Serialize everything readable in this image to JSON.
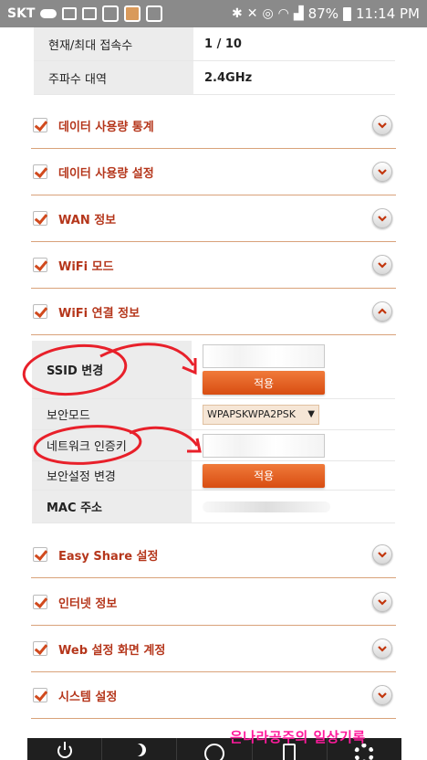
{
  "status_bar": {
    "carrier": "SKT",
    "battery": "87%",
    "time": "11:14 PM",
    "icons": [
      "cloud-icon",
      "image-icon",
      "image-icon",
      "photo-icon",
      "app-icon",
      "photo-icon",
      "bluetooth-icon",
      "mute-icon",
      "alarm-icon",
      "wifi-icon",
      "signal-icon",
      "battery-icon"
    ]
  },
  "info_table": {
    "rows": [
      {
        "key": "현재/최대 접속수",
        "value": "1 / 10"
      },
      {
        "key": "주파수 대역",
        "value": "2.4GHz"
      }
    ]
  },
  "sections": [
    {
      "label": "데이터 사용량 통계",
      "expanded": false
    },
    {
      "label": "데이터 사용량 설정",
      "expanded": false
    },
    {
      "label": "WAN 정보",
      "expanded": false
    },
    {
      "label": "WiFi 모드",
      "expanded": false
    },
    {
      "label": "WiFi 연결 정보",
      "expanded": true
    },
    {
      "label": "Easy Share 설정",
      "expanded": false
    },
    {
      "label": "인터넷 정보",
      "expanded": false
    },
    {
      "label": "Web 설정 화면 계정",
      "expanded": false
    },
    {
      "label": "시스템 설정",
      "expanded": false
    }
  ],
  "wifi_info": {
    "ssid_label": "SSID 변경",
    "ssid_value": "",
    "apply_label": "적용",
    "security_mode_label": "보안모드",
    "security_mode_value": "WPAPSKWPA2PSK",
    "network_key_label": "네트워크 인증키",
    "network_key_value": "",
    "security_change_label": "보안설정 변경",
    "security_apply_label": "적용",
    "mac_label": "MAC 주소",
    "mac_value": ""
  },
  "watermark": "은나라공주의 일상기록",
  "colors": {
    "accent": "#d84d12",
    "section_title": "#b5361b",
    "annotation": "#e8202a",
    "status_bar": "#8a8a8a"
  }
}
